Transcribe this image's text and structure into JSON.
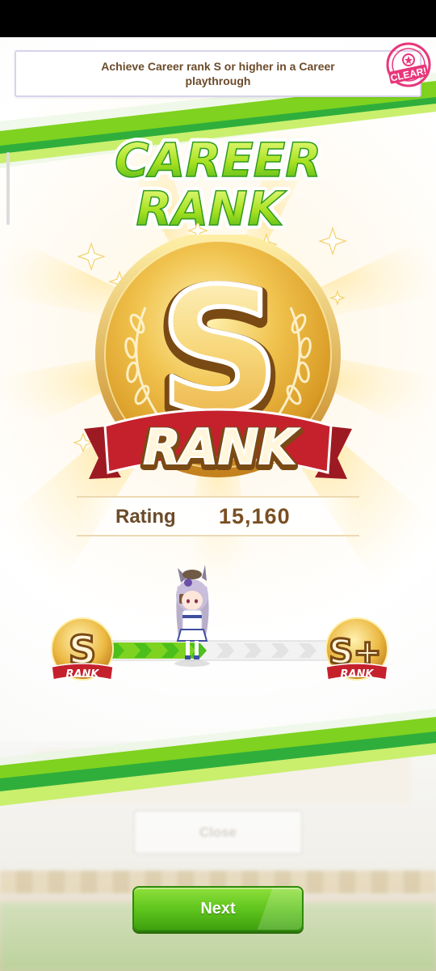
{
  "mission": {
    "text": "Achieve Career rank S or higher in a Career playthrough",
    "badge": "CLEAR!"
  },
  "title": {
    "line1": "CAREER",
    "line2": "RANK"
  },
  "medal": {
    "letter": "S",
    "ribbon": "RANK"
  },
  "rating": {
    "label": "Rating",
    "value": "15,160"
  },
  "progress": {
    "current_rank_letter": "S",
    "current_rank_label": "RANK",
    "next_rank_letter": "S+",
    "next_rank_label": "RANK",
    "filled_fraction": 0.4
  },
  "ghost_button": {
    "label": "Close"
  },
  "next_button": {
    "label": "Next"
  },
  "colors": {
    "accent_green": "#5cc21c",
    "gold": "#e6b23e",
    "ribbon_red": "#c5212d",
    "text_brown": "#6b4b2a",
    "clear_pink": "#e8367a"
  }
}
